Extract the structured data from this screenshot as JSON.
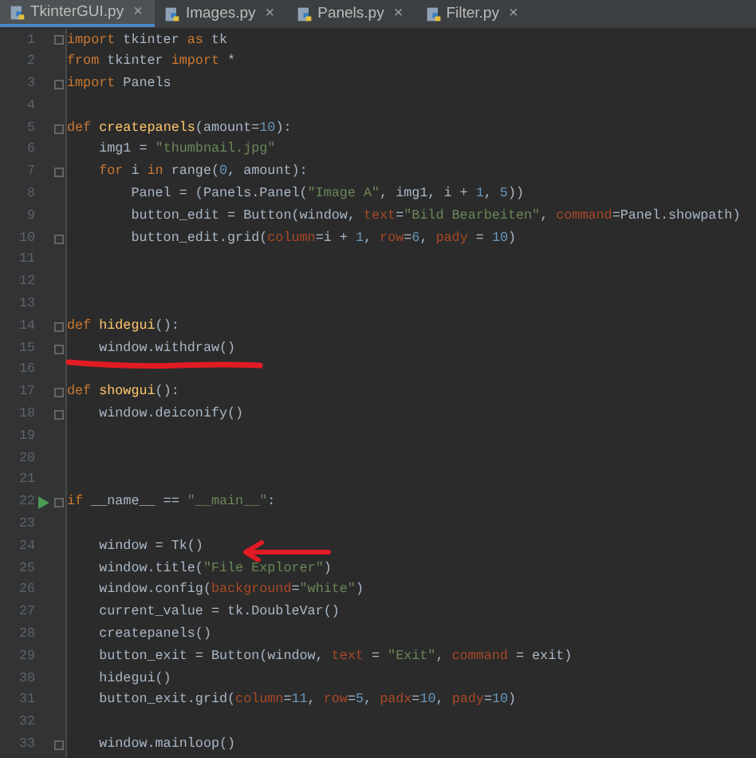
{
  "tabs": [
    {
      "label": "TkinterGUI.py",
      "selected": true,
      "close": "×"
    },
    {
      "label": "Images.py",
      "selected": false,
      "close": "×"
    },
    {
      "label": "Panels.py",
      "selected": false,
      "close": "×"
    },
    {
      "label": "Filter.py",
      "selected": false,
      "close": "×"
    }
  ],
  "lines": [
    {
      "number": "1",
      "fold": true,
      "run": false,
      "tokens": [
        {
          "kind": "kw",
          "text": "import"
        },
        {
          "kind": "plain",
          "text": " tkinter "
        },
        {
          "kind": "kw",
          "text": "as"
        },
        {
          "kind": "plain",
          "text": " tk"
        }
      ]
    },
    {
      "number": "2",
      "fold": false,
      "run": false,
      "tokens": [
        {
          "kind": "kw",
          "text": "from"
        },
        {
          "kind": "plain",
          "text": " tkinter "
        },
        {
          "kind": "kw",
          "text": "import"
        },
        {
          "kind": "plain",
          "text": " *"
        }
      ]
    },
    {
      "number": "3",
      "fold": true,
      "run": false,
      "tokens": [
        {
          "kind": "kw",
          "text": "import"
        },
        {
          "kind": "plain",
          "text": " Panels"
        }
      ]
    },
    {
      "number": "4",
      "fold": false,
      "run": false
    },
    {
      "number": "5",
      "fold": true,
      "run": false,
      "tokens": [
        {
          "kind": "kw",
          "text": "def "
        },
        {
          "kind": "fn",
          "text": "createpanels"
        },
        {
          "kind": "plain",
          "text": "(amount="
        },
        {
          "kind": "num",
          "text": "10"
        },
        {
          "kind": "plain",
          "text": "):"
        }
      ]
    },
    {
      "number": "6",
      "fold": false,
      "run": false,
      "tokens": [
        {
          "kind": "plain",
          "text": "    img1 = "
        },
        {
          "kind": "str",
          "text": "\"thumbnail.jpg\""
        }
      ]
    },
    {
      "number": "7",
      "fold": true,
      "run": false,
      "tokens": [
        {
          "kind": "kw",
          "text": "    for"
        },
        {
          "kind": "plain",
          "text": " i "
        },
        {
          "kind": "kw",
          "text": "in"
        },
        {
          "kind": "plain",
          "text": " range("
        },
        {
          "kind": "num",
          "text": "0"
        },
        {
          "kind": "plain",
          "text": ", amount):"
        }
      ]
    },
    {
      "number": "8",
      "fold": false,
      "run": false,
      "tokens": [
        {
          "kind": "plain",
          "text": "        Panel = (Panels.Panel("
        },
        {
          "kind": "str",
          "text": "\"Image A\""
        },
        {
          "kind": "plain",
          "text": ", img1, i + "
        },
        {
          "kind": "num",
          "text": "1"
        },
        {
          "kind": "plain",
          "text": ", "
        },
        {
          "kind": "num",
          "text": "5"
        },
        {
          "kind": "plain",
          "text": "))"
        }
      ]
    },
    {
      "number": "9",
      "fold": false,
      "run": false,
      "tokens": [
        {
          "kind": "plain",
          "text": "        button_edit = Button(window, "
        },
        {
          "kind": "param",
          "text": "text"
        },
        {
          "kind": "plain",
          "text": "="
        },
        {
          "kind": "str",
          "text": "\"Bild Bearbeiten\""
        },
        {
          "kind": "plain",
          "text": ", "
        },
        {
          "kind": "param",
          "text": "command"
        },
        {
          "kind": "plain",
          "text": "=Panel.showpath)"
        }
      ]
    },
    {
      "number": "10",
      "fold": true,
      "run": false,
      "tokens": [
        {
          "kind": "plain",
          "text": "        button_edit.grid("
        },
        {
          "kind": "param",
          "text": "column"
        },
        {
          "kind": "plain",
          "text": "=i + "
        },
        {
          "kind": "num",
          "text": "1"
        },
        {
          "kind": "plain",
          "text": ", "
        },
        {
          "kind": "param",
          "text": "row"
        },
        {
          "kind": "plain",
          "text": "="
        },
        {
          "kind": "num",
          "text": "6"
        },
        {
          "kind": "plain",
          "text": ", "
        },
        {
          "kind": "param",
          "text": "pady"
        },
        {
          "kind": "plain",
          "text": " = "
        },
        {
          "kind": "num",
          "text": "10"
        },
        {
          "kind": "plain",
          "text": ")"
        }
      ]
    },
    {
      "number": "11",
      "fold": false,
      "run": false
    },
    {
      "number": "12",
      "fold": false,
      "run": false
    },
    {
      "number": "13",
      "fold": false,
      "run": false
    },
    {
      "number": "14",
      "fold": true,
      "run": false,
      "tokens": [
        {
          "kind": "kw",
          "text": "def "
        },
        {
          "kind": "fn",
          "text": "hidegui"
        },
        {
          "kind": "plain",
          "text": "():"
        }
      ]
    },
    {
      "number": "15",
      "fold": true,
      "run": false,
      "tokens": [
        {
          "kind": "plain",
          "text": "    window.withdraw()"
        }
      ]
    },
    {
      "number": "16",
      "fold": false,
      "run": false
    },
    {
      "number": "17",
      "fold": true,
      "run": false,
      "tokens": [
        {
          "kind": "kw",
          "text": "def "
        },
        {
          "kind": "fn",
          "text": "showgui"
        },
        {
          "kind": "plain",
          "text": "():"
        }
      ]
    },
    {
      "number": "18",
      "fold": true,
      "run": false,
      "tokens": [
        {
          "kind": "plain",
          "text": "    window.deiconify()"
        }
      ]
    },
    {
      "number": "19",
      "fold": false,
      "run": false
    },
    {
      "number": "20",
      "fold": false,
      "run": false
    },
    {
      "number": "21",
      "fold": false,
      "run": false
    },
    {
      "number": "22",
      "fold": true,
      "run": true,
      "tokens": [
        {
          "kind": "kw",
          "text": "if"
        },
        {
          "kind": "plain",
          "text": " __name__ == "
        },
        {
          "kind": "str",
          "text": "\"__main__\""
        },
        {
          "kind": "plain",
          "text": ":"
        }
      ]
    },
    {
      "number": "23",
      "fold": false,
      "run": false
    },
    {
      "number": "24",
      "fold": false,
      "run": false,
      "tokens": [
        {
          "kind": "plain",
          "text": "    window = Tk()"
        }
      ]
    },
    {
      "number": "25",
      "fold": false,
      "run": false,
      "tokens": [
        {
          "kind": "plain",
          "text": "    window.title("
        },
        {
          "kind": "str",
          "text": "\"File Explorer\""
        },
        {
          "kind": "plain",
          "text": ")"
        }
      ]
    },
    {
      "number": "26",
      "fold": false,
      "run": false,
      "tokens": [
        {
          "kind": "plain",
          "text": "    window.config("
        },
        {
          "kind": "param",
          "text": "background"
        },
        {
          "kind": "plain",
          "text": "="
        },
        {
          "kind": "str",
          "text": "\"white\""
        },
        {
          "kind": "plain",
          "text": ")"
        }
      ]
    },
    {
      "number": "27",
      "fold": false,
      "run": false,
      "tokens": [
        {
          "kind": "plain",
          "text": "    current_value = tk.DoubleVar()"
        }
      ]
    },
    {
      "number": "28",
      "fold": false,
      "run": false,
      "tokens": [
        {
          "kind": "plain",
          "text": "    createpanels()"
        }
      ]
    },
    {
      "number": "29",
      "fold": false,
      "run": false,
      "tokens": [
        {
          "kind": "plain",
          "text": "    button_exit = Button(window, "
        },
        {
          "kind": "param",
          "text": "text"
        },
        {
          "kind": "plain",
          "text": " = "
        },
        {
          "kind": "str",
          "text": "\"Exit\""
        },
        {
          "kind": "plain",
          "text": ", "
        },
        {
          "kind": "param",
          "text": "command"
        },
        {
          "kind": "plain",
          "text": " = exit)"
        }
      ]
    },
    {
      "number": "30",
      "fold": false,
      "run": false,
      "tokens": [
        {
          "kind": "plain",
          "text": "    hidegui()"
        }
      ]
    },
    {
      "number": "31",
      "fold": false,
      "run": false,
      "tokens": [
        {
          "kind": "plain",
          "text": "    button_exit.grid("
        },
        {
          "kind": "param",
          "text": "column"
        },
        {
          "kind": "plain",
          "text": "="
        },
        {
          "kind": "num",
          "text": "11"
        },
        {
          "kind": "plain",
          "text": ", "
        },
        {
          "kind": "param",
          "text": "row"
        },
        {
          "kind": "plain",
          "text": "="
        },
        {
          "kind": "num",
          "text": "5"
        },
        {
          "kind": "plain",
          "text": ", "
        },
        {
          "kind": "param",
          "text": "padx"
        },
        {
          "kind": "plain",
          "text": "="
        },
        {
          "kind": "num",
          "text": "10"
        },
        {
          "kind": "plain",
          "text": ", "
        },
        {
          "kind": "param",
          "text": "pady"
        },
        {
          "kind": "plain",
          "text": "="
        },
        {
          "kind": "num",
          "text": "10"
        },
        {
          "kind": "plain",
          "text": ")"
        }
      ]
    },
    {
      "number": "32",
      "fold": false,
      "run": false
    },
    {
      "number": "33",
      "fold": true,
      "run": false,
      "tokens": [
        {
          "kind": "plain",
          "text": "    window.mainloop()"
        }
      ]
    }
  ]
}
